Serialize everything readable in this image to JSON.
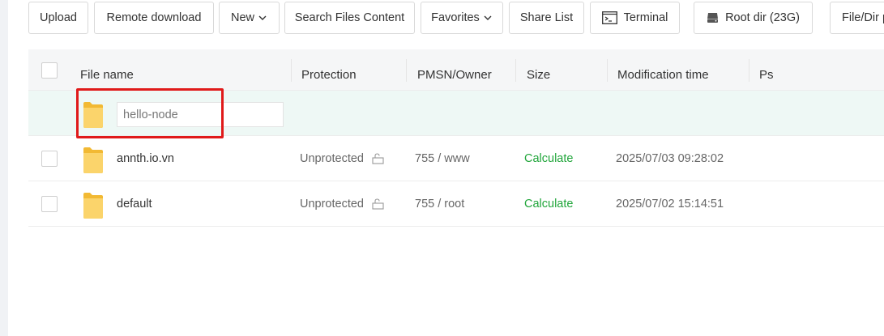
{
  "toolbar": {
    "upload": "Upload",
    "remote_download": "Remote download",
    "new": "New",
    "search_files_content": "Search Files Content",
    "favorites": "Favorites",
    "share_list": "Share List",
    "terminal": "Terminal",
    "root_dir": "Root dir (23G)",
    "file_dir": "File/Dir p"
  },
  "table": {
    "headers": {
      "file_name": "File name",
      "protection": "Protection",
      "pmsn_owner": "PMSN/Owner",
      "size": "Size",
      "modification_time": "Modification time",
      "ps": "Ps"
    },
    "new_folder_input": {
      "value": "hello-node"
    },
    "rows": [
      {
        "name": "annth.io.vn",
        "protection": "Unprotected",
        "pmsn_owner": "755 / www",
        "size": "Calculate",
        "modified": "2025/07/03 09:28:02"
      },
      {
        "name": "default",
        "protection": "Unprotected",
        "pmsn_owner": "755 / root",
        "size": "Calculate",
        "modified": "2025/07/02 15:14:51"
      }
    ]
  },
  "colors": {
    "accent_green": "#20a53a",
    "highlight_red": "#e01a1a",
    "folder_yellow": "#f7c948",
    "edit_row_bg": "#eef8f5"
  },
  "icons": [
    "chevron-down-icon",
    "terminal-icon",
    "disk-icon",
    "folder-icon",
    "lock-open-icon"
  ]
}
